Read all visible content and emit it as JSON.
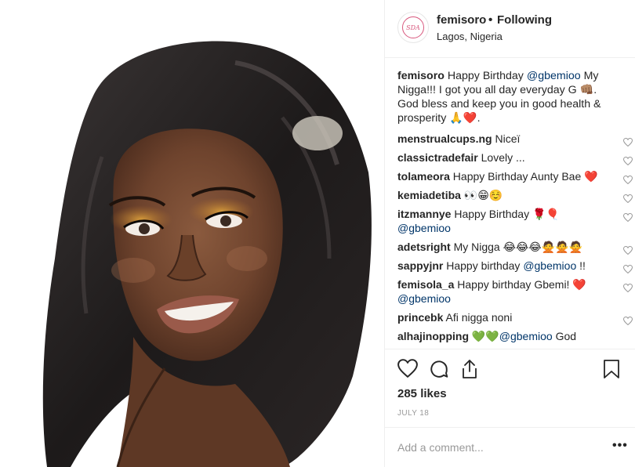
{
  "header": {
    "avatar_text": "SDA",
    "username": "femisoro",
    "separator": "•",
    "follow_status": "Following",
    "location": "Lagos, Nigeria"
  },
  "caption": {
    "user": "femisoro",
    "text_1": " Happy Birthday ",
    "mention": "@gbemioo",
    "text_2": " My Nigga!!! I got you all day everyday G 👊🏽. God bless and keep you in good health & prosperity 🙏❤️."
  },
  "comments": [
    {
      "user": "menstrualcups.ng",
      "text": " Niceї",
      "mention": "",
      "text_after": ""
    },
    {
      "user": "classictradefair",
      "text": " Lovely ...",
      "mention": "",
      "text_after": ""
    },
    {
      "user": "tolameora",
      "text": " Happy Birthday Aunty Bae ❤️",
      "mention": "",
      "text_after": ""
    },
    {
      "user": "kemiadetiba",
      "text": " 👀😁☺️",
      "mention": "",
      "text_after": ""
    },
    {
      "user": "itzmannye",
      "text": " Happy Birthday 🌹🎈 ",
      "mention": "@gbemioo",
      "text_after": ""
    },
    {
      "user": "adetsright",
      "text": " My Nigga 😂😂😂🙅🙅🙅",
      "mention": "",
      "text_after": ""
    },
    {
      "user": "sappyjnr",
      "text": " Happy birthday ",
      "mention": "@gbemioo",
      "text_after": " !!"
    },
    {
      "user": "femisola_a",
      "text": " Happy birthday Gbemi! ❤️ ",
      "mention": "@gbemioo",
      "text_after": ""
    },
    {
      "user": "princebk",
      "text": " Afi nigga noni",
      "mention": "",
      "text_after": ""
    },
    {
      "user": "alhajinopping",
      "text": " 💚💚",
      "mention": "@gbemioo",
      "text_after": " God"
    }
  ],
  "likes": "285 likes",
  "date": "JULY 18",
  "add_comment": {
    "placeholder": "Add a comment..."
  },
  "more_label": "•••",
  "colors": {
    "link": "#003569",
    "muted": "#999999",
    "text": "#262626",
    "border": "#efefef",
    "avatar_accent": "#d8577d"
  },
  "icons": {
    "like": "heart-outline-icon",
    "comment": "speech-bubble-icon",
    "share": "share-upload-icon",
    "save": "bookmark-icon"
  }
}
